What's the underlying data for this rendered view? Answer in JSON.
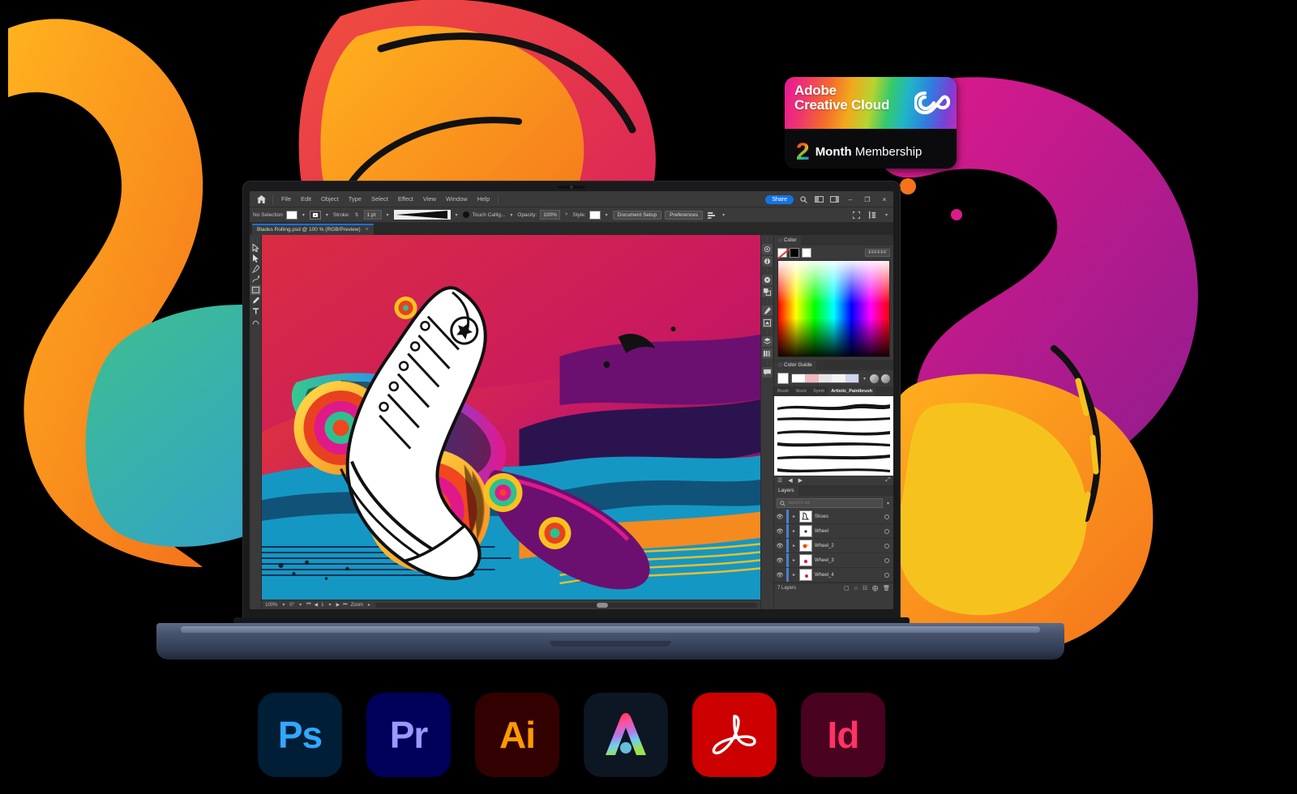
{
  "badge": {
    "brand_line1": "Adobe",
    "brand_line2": "Creative Cloud",
    "logo_icon": "creative-cloud-infinity-icon",
    "duration_number": "2",
    "duration_unit": "Month",
    "duration_word": "Membership"
  },
  "app": {
    "title": "Adobe Illustrator",
    "home_icon": "home-icon",
    "menu": [
      {
        "label": "File"
      },
      {
        "label": "Edit"
      },
      {
        "label": "Object"
      },
      {
        "label": "Type"
      },
      {
        "label": "Select"
      },
      {
        "label": "Effect"
      },
      {
        "label": "View"
      },
      {
        "label": "Window"
      },
      {
        "label": "Help"
      }
    ],
    "menubar_right": {
      "share_label": "Share",
      "search_icon": "search-icon",
      "arrange_icon": "arrange-documents-icon",
      "workspace_icon": "workspace-switcher-icon",
      "minimize": "–",
      "maximize": "❐",
      "close": "×"
    },
    "control_bar": {
      "selection_status": "No Selection",
      "fill_swatch": "#FFFFFF",
      "stroke_swatch": "#FFFFFF",
      "stroke_label": "Stroke:",
      "stroke_weight": "1 pt",
      "profile_label": "width-profile-preview",
      "brush_label": "Touch Callig...",
      "opacity_label": "Opacity:",
      "opacity_value": "100%",
      "style_label": "Style:",
      "document_setup_label": "Document Setup",
      "preferences_label": "Preferences",
      "align_icon": "align-options-icon"
    },
    "document_tab": {
      "name": "Blades Rolling.psd @ 100 % (RGB/Preview)",
      "close": "×"
    },
    "tools": [
      {
        "name": "selection-tool",
        "glyph": "arrow"
      },
      {
        "name": "direct-selection-tool",
        "glyph": "arrow-hollow"
      },
      {
        "name": "pen-tool",
        "glyph": "pen"
      },
      {
        "name": "curvature-tool",
        "glyph": "curvature"
      },
      {
        "name": "rectangle-tool",
        "glyph": "rect",
        "selected": true
      },
      {
        "name": "paintbrush-tool",
        "glyph": "brush"
      },
      {
        "name": "type-tool",
        "glyph": "T"
      },
      {
        "name": "shaper-tool",
        "glyph": "shaper"
      }
    ],
    "status_bar": {
      "zoom_value": "100%",
      "rotation_value": "0°",
      "nav_first": "⏮",
      "nav_prev": "◀",
      "artboard_value": "1",
      "nav_next": "▶",
      "nav_last": "⏭",
      "tool_name": "Zoom"
    },
    "panels": {
      "color": {
        "tab_label": "Color",
        "none_swatch": "none-swatch",
        "black_swatch": "#000000",
        "white_swatch": "#FFFFFF",
        "hex_value": "FFFFFF"
      },
      "color_guide": {
        "tab_label": "Color Guide",
        "base_swatch": "#FFFFFF",
        "harmony_icon": "harmony-rules-icon",
        "edit_icon": "edit-colors-icon"
      },
      "brush_library": {
        "tabs": [
          {
            "label": "Brush"
          },
          {
            "label": "Stock"
          },
          {
            "label": "Symb"
          },
          {
            "label": "Artistic_Paintbrush",
            "active": true
          }
        ],
        "menu_icon": "library-menu-icon",
        "prev_icon": "◀",
        "next_icon": "▶",
        "expand_icon": "expand-icon"
      },
      "layers": {
        "tab_label": "Layers",
        "search_icon": "search-icon",
        "search_placeholder": "Search All",
        "filter_icon": "filter-icon",
        "rows": [
          {
            "name": "Shoes",
            "visible": true,
            "selected": false
          },
          {
            "name": "Wheel",
            "visible": true,
            "selected": false
          },
          {
            "name": "Wheel_2",
            "visible": true,
            "selected": false
          },
          {
            "name": "Wheel_3",
            "visible": true,
            "selected": false
          },
          {
            "name": "Wheel_4",
            "visible": true,
            "selected": false
          }
        ],
        "count_label": "7 Layers",
        "locate_icon": "locate-object-icon",
        "mask_icon": "make-mask-icon",
        "fx_icon": "new-sublayer-icon",
        "new_layer_icon": "new-layer-icon",
        "delete_icon": "delete-layer-icon"
      }
    }
  },
  "app_strip": [
    {
      "name": "photoshop",
      "label": "Ps",
      "bg": "#001E36",
      "fg": "#31A8FF"
    },
    {
      "name": "premiere-pro",
      "label": "Pr",
      "bg": "#00005B",
      "fg": "#9999FF"
    },
    {
      "name": "illustrator",
      "label": "Ai",
      "bg": "#330000",
      "fg": "#FF9A00"
    },
    {
      "name": "adobe-express",
      "label": "",
      "bg": "#0D1623",
      "fg": "#E61682"
    },
    {
      "name": "acrobat",
      "label": "",
      "bg": "#CC0000",
      "fg": "#FFFFFF"
    },
    {
      "name": "indesign",
      "label": "Id",
      "bg": "#49021F",
      "fg": "#FF3366"
    }
  ],
  "colors": {
    "accent_blue": "#1473E6",
    "panel_bg": "#3A3A3A",
    "canvas_bg": "#1F1F1F",
    "laptop_body": "#47536C"
  }
}
